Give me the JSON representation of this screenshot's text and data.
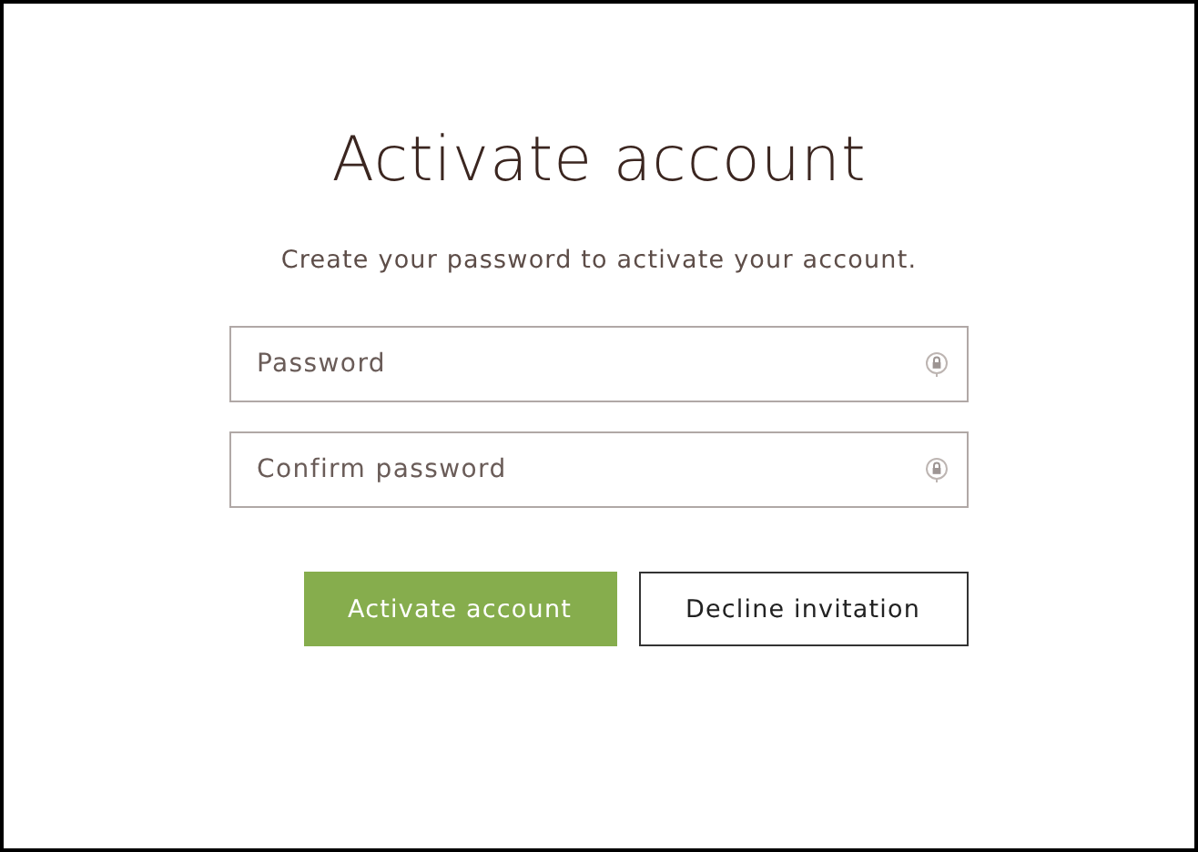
{
  "title": "Activate account",
  "subtitle": "Create your password to activate your account.",
  "fields": [
    {
      "placeholder": "Password"
    },
    {
      "placeholder": "Confirm password"
    }
  ],
  "buttons": [
    {
      "label": "Activate account",
      "kind": "primary"
    },
    {
      "label": "Decline invitation",
      "kind": "secondary"
    }
  ]
}
